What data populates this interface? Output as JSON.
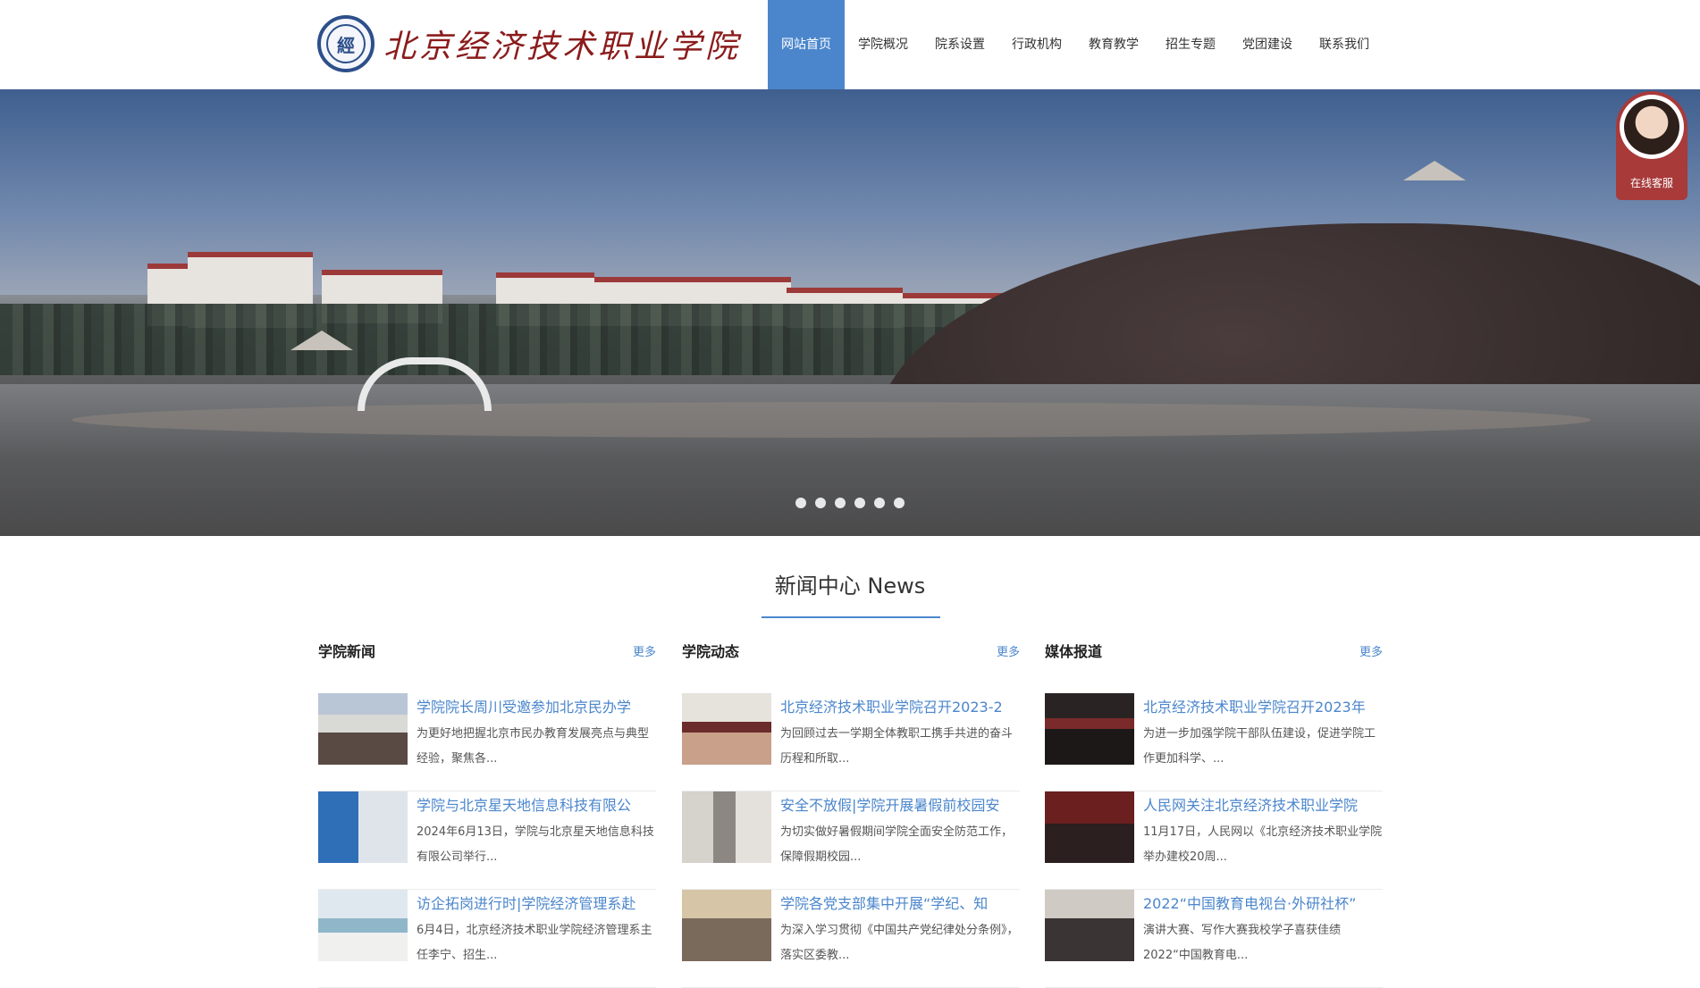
{
  "header": {
    "logo_text": "北京经济技术职业学院",
    "nav": [
      "网站首页",
      "学院概况",
      "院系设置",
      "行政机构",
      "教育教学",
      "招生专题",
      "党团建设",
      "联系我们"
    ],
    "nav_active_index": 0
  },
  "banner": {
    "slide_count": 6,
    "active_slide": 0
  },
  "service": {
    "label": "在线客服"
  },
  "news": {
    "title": "新闻中心 News",
    "columns": [
      {
        "title": "学院新闻",
        "more": "更多",
        "items": [
          {
            "title": "学院院长周川受邀参加北京民办学",
            "desc": "为更好地把握北京市民办教育发展亮点与典型经验，聚焦各..."
          },
          {
            "title": "学院与北京星天地信息科技有限公",
            "desc": "2024年6月13日，学院与北京星天地信息科技有限公司举行..."
          },
          {
            "title": "访企拓岗进行时|学院经济管理系赴",
            "desc": "6月4日，北京经济技术职业学院经济管理系主任李宁、招生..."
          }
        ]
      },
      {
        "title": "学院动态",
        "more": "更多",
        "items": [
          {
            "title": "北京经济技术职业学院召开2023-2",
            "desc": "为回顾过去一学期全体教职工携手共进的奋斗历程和所取..."
          },
          {
            "title": "安全不放假|学院开展暑假前校园安",
            "desc": "为切实做好暑假期间学院全面安全防范工作，保障假期校园..."
          },
          {
            "title": "学院各党支部集中开展“学纪、知",
            "desc": "为深入学习贯彻《中国共产党纪律处分条例》，落实区委教..."
          }
        ]
      },
      {
        "title": "媒体报道",
        "more": "更多",
        "items": [
          {
            "title": "北京经济技术职业学院召开2023年",
            "desc": "为进一步加强学院干部队伍建设，促进学院工作更加科学、..."
          },
          {
            "title": "人民网关注北京经济技术职业学院",
            "desc": "11月17日，人民网以《北京经济技术职业学院举办建校20周..."
          },
          {
            "title": "2022“中国教育电视台·外研社杯”",
            "desc": "演讲大赛、写作大赛我校学子喜获佳绩2022“中国教育电..."
          }
        ]
      }
    ]
  },
  "colors": {
    "accent": "#4b86cc",
    "logo_red": "#8b1c1c",
    "service_red": "#a83a3a"
  }
}
